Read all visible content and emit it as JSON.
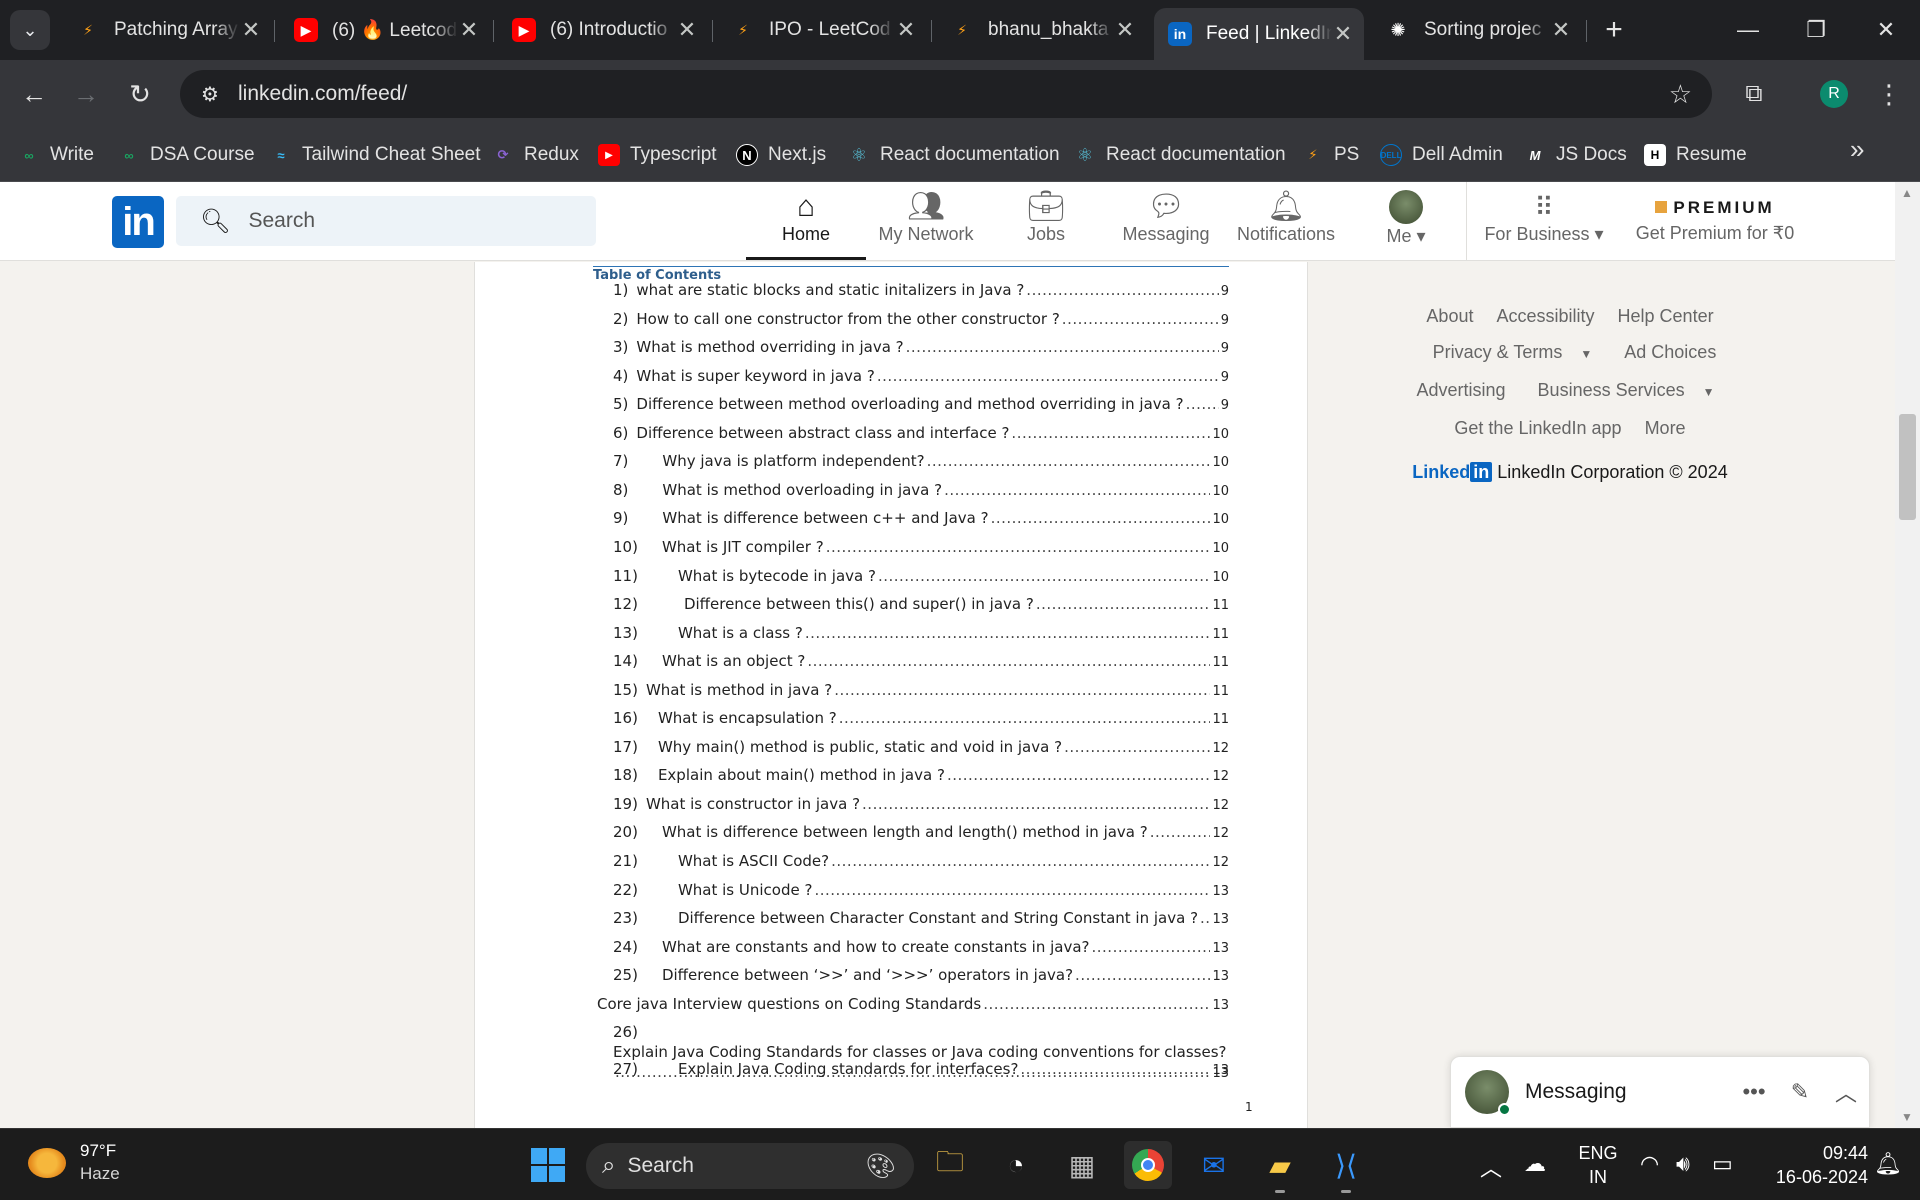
{
  "browser": {
    "tabs": [
      {
        "title": "Patching Array",
        "favicon": "leetcode-icon",
        "fav_color": "#ffa116",
        "active": false
      },
      {
        "title": "(6) 🔥 Leetcod",
        "favicon": "youtube-icon",
        "fav_color": "#ff0000",
        "active": false
      },
      {
        "title": "(6) Introductio",
        "favicon": "youtube-icon",
        "fav_color": "#ff0000",
        "active": false
      },
      {
        "title": "IPO - LeetCod",
        "favicon": "leetcode-icon",
        "fav_color": "#ffa116",
        "active": false
      },
      {
        "title": "bhanu_bhakta",
        "favicon": "leetcode-icon",
        "fav_color": "#ffa116",
        "active": false
      },
      {
        "title": "Feed | LinkedIn",
        "favicon": "linkedin-icon",
        "fav_color": "#0a66c2",
        "active": true
      },
      {
        "title": "Sorting projec",
        "favicon": "chatgpt-icon",
        "fav_color": "#ffffff",
        "active": false
      }
    ],
    "url": "linkedin.com/feed/",
    "profile_initial": "R",
    "bookmarks": [
      {
        "label": "Write",
        "icon": "write-icon"
      },
      {
        "label": "DSA Course",
        "icon": "dsa-icon"
      },
      {
        "label": "Tailwind Cheat Sheet",
        "icon": "tailwind-icon"
      },
      {
        "label": "Redux",
        "icon": "redux-icon"
      },
      {
        "label": "Typescript",
        "icon": "youtube-icon"
      },
      {
        "label": "Next.js",
        "icon": "nextjs-icon"
      },
      {
        "label": "React documentation",
        "icon": "react-icon"
      },
      {
        "label": "React documentation",
        "icon": "react-icon"
      },
      {
        "label": "PS",
        "icon": "leetcode-icon"
      },
      {
        "label": "Dell Admin",
        "icon": "dell-icon"
      },
      {
        "label": "JS Docs",
        "icon": "jsdocs-icon"
      },
      {
        "label": "Resume",
        "icon": "resume-icon"
      }
    ]
  },
  "linkedin": {
    "logo": "in",
    "search_placeholder": "Search",
    "nav": [
      {
        "label": "Home",
        "icon": "home-icon",
        "active": true
      },
      {
        "label": "My Network",
        "icon": "network-icon",
        "active": false
      },
      {
        "label": "Jobs",
        "icon": "briefcase-icon",
        "active": false
      },
      {
        "label": "Messaging",
        "icon": "messaging-icon",
        "active": false
      },
      {
        "label": "Notifications",
        "icon": "bell-icon",
        "active": false
      },
      {
        "label": "Me",
        "icon": "avatar",
        "active": false
      },
      {
        "label": "For Business",
        "icon": "grid-icon",
        "active": false
      }
    ],
    "premium": {
      "title": "PREMIUM",
      "subtitle": "Get Premium for ₹0"
    },
    "footer": {
      "rows": [
        [
          "About",
          "Accessibility",
          "Help Center"
        ],
        [
          "Privacy & Terms",
          "Ad Choices"
        ],
        [
          "Advertising",
          "Business Services"
        ],
        [
          "Get the LinkedIn app",
          "More"
        ]
      ],
      "brand_word": "Linked",
      "brand_box": "in",
      "corp": "LinkedIn Corporation © 2024"
    },
    "messaging_title": "Messaging"
  },
  "document": {
    "toc_title": "Table of Contents",
    "entries": [
      {
        "num": "1)",
        "text": "what are static blocks and static initalizers in Java ?",
        "page": "9"
      },
      {
        "num": "2)",
        "text": "How to call one constructor from the other constructor ?",
        "page": "9"
      },
      {
        "num": "3)",
        "text": "What is method overriding in java ?",
        "page": "9"
      },
      {
        "num": "4)",
        "text": "What is super keyword in java ?",
        "page": "9"
      },
      {
        "num": "5)",
        "text": "Difference between method overloading and method overriding in java ?",
        "page": "9"
      },
      {
        "num": "6)",
        "text": "Difference between abstract class and interface ?",
        "page": "10"
      },
      {
        "num": "7)",
        "text": "Why java is platform independent?",
        "page": "10"
      },
      {
        "num": "8)",
        "text": "What is method overloading in java ?",
        "page": "10"
      },
      {
        "num": "9)",
        "text": "What is difference between c++ and Java ?",
        "page": "10"
      },
      {
        "num": "10)",
        "text": "What is JIT compiler ?",
        "page": "10"
      },
      {
        "num": "11)",
        "text": "What is bytecode in java ?",
        "page": "10"
      },
      {
        "num": "12)",
        "text": "Difference between this() and super() in java ?",
        "page": "11"
      },
      {
        "num": "13)",
        "text": "What is a class ?",
        "page": "11"
      },
      {
        "num": "14)",
        "text": "What is an object ?",
        "page": "11"
      },
      {
        "num": "15)",
        "text": "What is method in java ?",
        "page": "11"
      },
      {
        "num": "16)",
        "text": "What is encapsulation ?",
        "page": "11"
      },
      {
        "num": "17)",
        "text": "Why main() method is public, static and void in java ?",
        "page": "12"
      },
      {
        "num": "18)",
        "text": "Explain about main() method in java ?",
        "page": "12"
      },
      {
        "num": "19)",
        "text": "What is constructor in java ?",
        "page": "12"
      },
      {
        "num": "20)",
        "text": "What is difference between length and length() method in java ?",
        "page": "12"
      },
      {
        "num": "21)",
        "text": "What  is ASCII Code?",
        "page": "12"
      },
      {
        "num": "22)",
        "text": "What is Unicode ?",
        "page": "13"
      },
      {
        "num": "23)",
        "text": "Difference between Character Constant and String Constant in java ?",
        "page": "13"
      },
      {
        "num": "24)",
        "text": "What are constants and how to create constants in java?",
        "page": "13"
      },
      {
        "num": "25)",
        "text": "Difference between ‘>>’ and ‘>>>’ operators in java?",
        "page": "13"
      },
      {
        "num": "",
        "text": "Core java Interview questions on Coding Standards",
        "page": "13"
      },
      {
        "num": "26)",
        "text": "Explain Java Coding Standards for classes or Java coding conventions for classes?",
        "page": "13"
      },
      {
        "num": "27)",
        "text": "Explain Java Coding standards for interfaces?",
        "page": "13"
      }
    ],
    "page_number": "1"
  },
  "taskbar": {
    "weather_temp": "97°F",
    "weather_desc": "Haze",
    "search_placeholder": "Search",
    "lang_top": "ENG",
    "lang_bottom": "IN",
    "time": "09:44",
    "date": "16-06-2024"
  }
}
